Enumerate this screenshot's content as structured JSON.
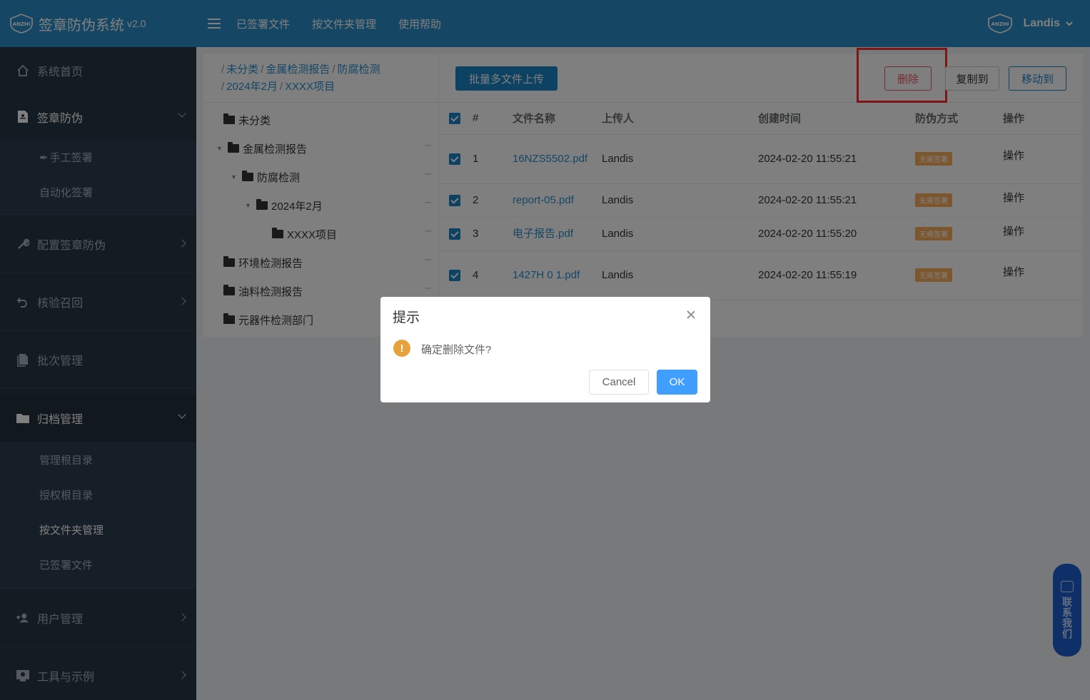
{
  "app": {
    "title": "签章防伪系统",
    "version": "v2.0",
    "logo_text": "ANZHI"
  },
  "topnav": {
    "items": [
      "已签署文件",
      "按文件夹管理",
      "使用帮助"
    ]
  },
  "user": {
    "name": "Landis"
  },
  "sidebar": {
    "items": [
      {
        "label": "系统首页",
        "icon": "home-icon"
      },
      {
        "label": "签章防伪",
        "icon": "document-icon",
        "expanded": true
      },
      {
        "label": "配置签章防伪",
        "icon": "wrench-icon"
      },
      {
        "label": "核验召回",
        "icon": "undo-icon"
      },
      {
        "label": "批次管理",
        "icon": "file-icon"
      },
      {
        "label": "归档管理",
        "icon": "folder-icon",
        "expanded": true
      },
      {
        "label": "用户管理",
        "icon": "users-icon"
      },
      {
        "label": "工具与示例",
        "icon": "tools-icon"
      }
    ],
    "sign_sub": [
      "手工签署",
      "自动化签署"
    ],
    "archive_sub": [
      "管理根目录",
      "授权根目录",
      "按文件夹管理",
      "已签署文件"
    ]
  },
  "breadcrumb": {
    "items": [
      "未分类",
      "金属检测报告",
      "防腐检测",
      "2024年2月",
      "XXXX项目"
    ]
  },
  "tree": {
    "nodes": [
      {
        "label": "未分类",
        "level": 0
      },
      {
        "label": "金属检测报告",
        "level": 0
      },
      {
        "label": "防腐检测",
        "level": 1
      },
      {
        "label": "2024年2月",
        "level": 2
      },
      {
        "label": "XXXX项目",
        "level": 3
      },
      {
        "label": "环境检测报告",
        "level": 0
      },
      {
        "label": "油料检测报告",
        "level": 0
      },
      {
        "label": "元器件检测部门",
        "level": 0
      }
    ],
    "more": "···"
  },
  "toolbar": {
    "upload": "批量多文件上传",
    "delete": "删除",
    "copy": "复制到",
    "move": "移动到"
  },
  "table": {
    "headers": [
      "#",
      "文件名称",
      "上传人",
      "创建时间",
      "防伪方式",
      "操作"
    ],
    "rows": [
      {
        "no": "1",
        "name": "16NZS5502.pdf",
        "uploader": "Landis",
        "created": "2024-02-20 11:55:21",
        "method": "无需签署",
        "op": "操作"
      },
      {
        "no": "2",
        "name": "report-05.pdf",
        "uploader": "Landis",
        "created": "2024-02-20 11:55:21",
        "method": "无需签署",
        "op": "操作"
      },
      {
        "no": "3",
        "name": "电子报告.pdf",
        "uploader": "Landis",
        "created": "2024-02-20 11:55:20",
        "method": "无需签署",
        "op": "操作"
      },
      {
        "no": "4",
        "name": "1427H 0 1.pdf",
        "uploader": "Landis",
        "created": "2024-02-20 11:55:19",
        "method": "无需签署",
        "op": "操作"
      }
    ]
  },
  "dialog": {
    "title": "提示",
    "message": "确定删除文件?",
    "cancel": "Cancel",
    "ok": "OK"
  },
  "contact": {
    "label": "联系我们"
  },
  "colors": {
    "header": "#2a8fc9",
    "sidebar": "#293846",
    "primary": "#1c84c6",
    "danger": "#ed5565",
    "warning": "#f8ac59",
    "highlight": "#ff2a2a"
  }
}
